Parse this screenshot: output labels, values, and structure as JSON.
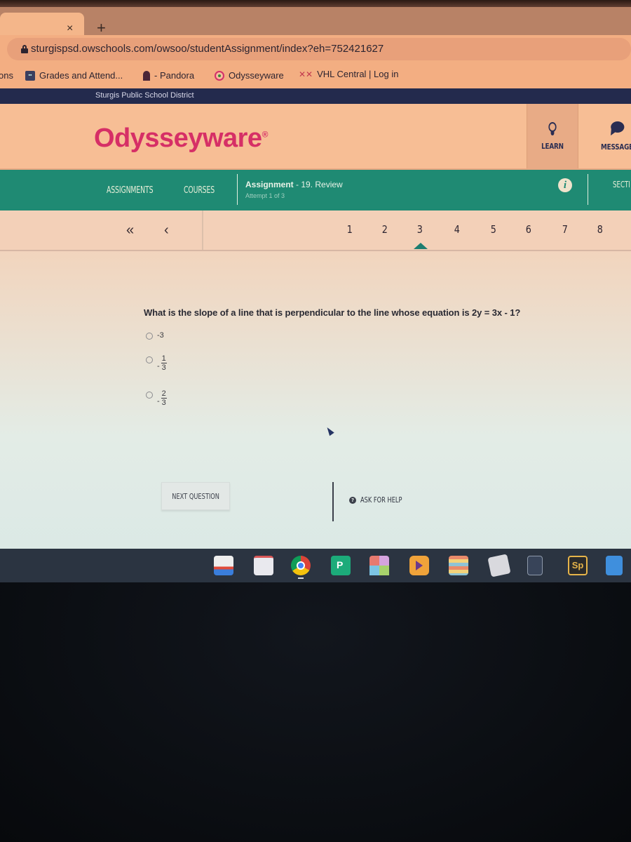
{
  "browser": {
    "tab": {
      "close_icon": "×",
      "new_tab_icon": "+"
    },
    "url": "sturgispsd.owschools.com/owsoo/studentAssignment/index?eh=752421627",
    "bookmarks": [
      {
        "label": "ons",
        "icon": "none"
      },
      {
        "label": "Grades and Attend...",
        "icon": "grades-icon"
      },
      {
        "label": "- Pandora",
        "icon": "pandora-icon"
      },
      {
        "label": "Odysseyware",
        "icon": "odysseyware-icon"
      },
      {
        "label": "VHL Central | Log in",
        "icon": "vhl-icon"
      }
    ]
  },
  "district": {
    "name": "Sturgis Public School District"
  },
  "header": {
    "logo": "Odysseyware",
    "logo_mark": "®",
    "learn_label": "LEARN",
    "message_label": "MESSAGE"
  },
  "nav": {
    "assignments_label": "ASSIGNMENTS",
    "courses_label": "COURSES",
    "assignment_prefix": "Assignment",
    "assignment_name": "- 19. Review",
    "attempt": "Attempt 1 of 3",
    "info_icon": "i",
    "section_label": "SECTI"
  },
  "pager": {
    "first_icon": "«",
    "prev_icon": "‹",
    "pages": [
      "1",
      "2",
      "3",
      "4",
      "5",
      "6",
      "7",
      "8"
    ],
    "current_page": "3"
  },
  "question": {
    "text": "What is the slope of a line that is perpendicular to the line whose equation is 2y = 3x - 1?",
    "choices": [
      {
        "type": "plain",
        "label": "-3"
      },
      {
        "type": "fraction",
        "sign": "-",
        "numerator": "1",
        "denominator": "3"
      },
      {
        "type": "fraction",
        "sign": "-",
        "numerator": "2",
        "denominator": "3"
      }
    ],
    "selected": null
  },
  "actions": {
    "next_label": "NEXT QUESTION",
    "help_label": "ASK FOR HELP"
  },
  "shelf": {
    "apps": [
      "chrome-web-store-icon",
      "graph-app-icon",
      "chrome-icon",
      "pear-deck-icon",
      "grid-app-icon",
      "video-player-icon",
      "books-app-icon",
      "docs-edit-icon",
      "calculator-icon",
      "adobe-spark-icon",
      "google-docs-icon"
    ],
    "spark_label": "Sp"
  }
}
